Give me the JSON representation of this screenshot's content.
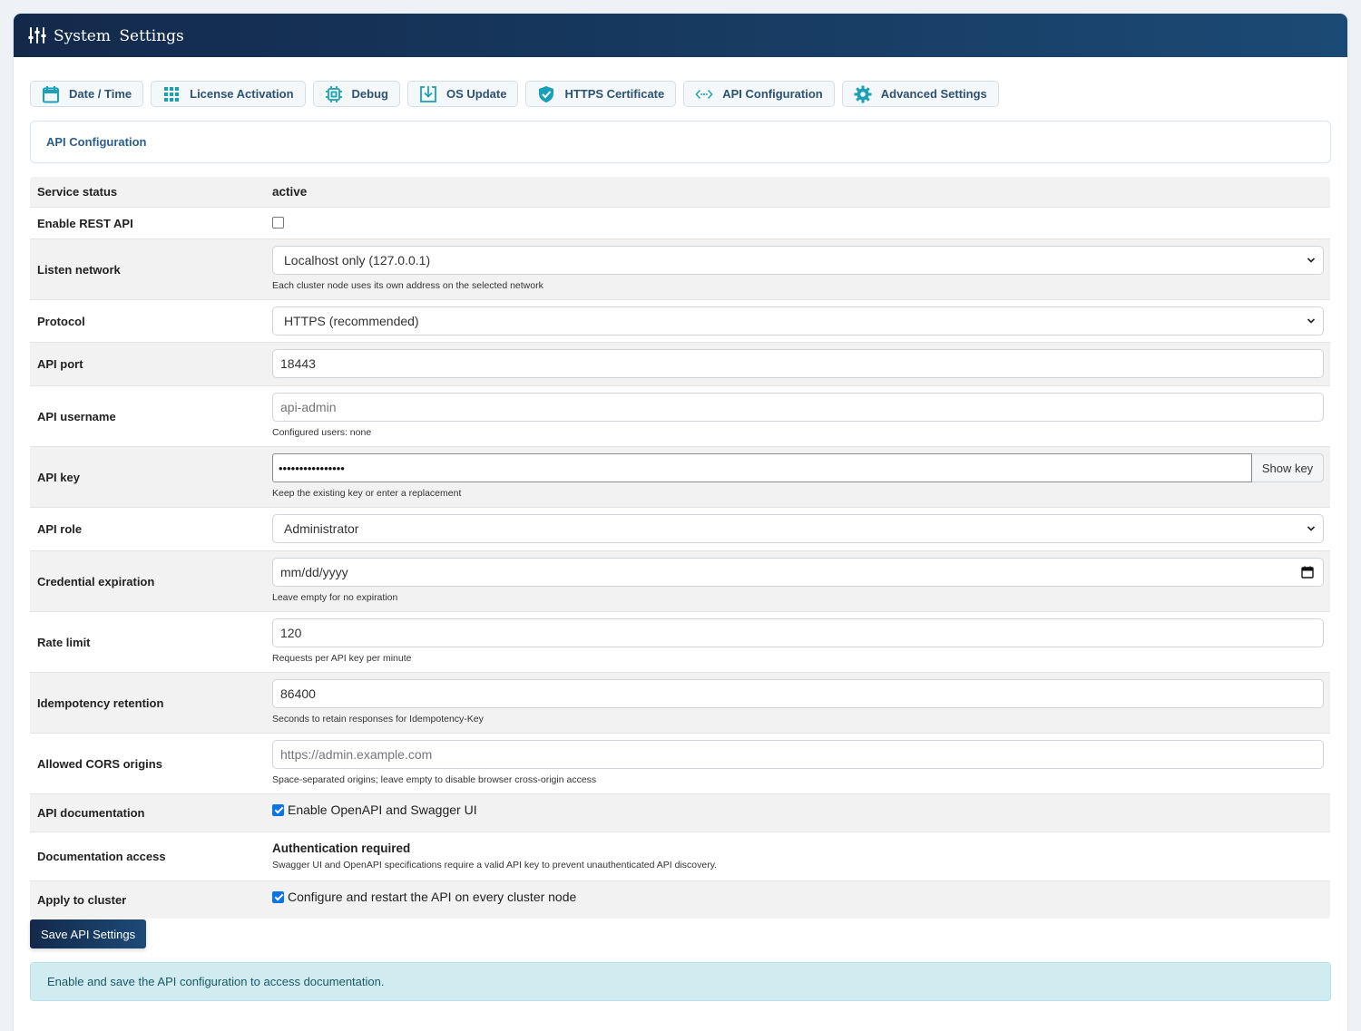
{
  "window": {
    "title": "System  Settings"
  },
  "tabs": [
    {
      "label": "Date / Time",
      "icon": "calendar-icon"
    },
    {
      "label": "License Activation",
      "icon": "grid-icon"
    },
    {
      "label": "Debug",
      "icon": "chip-icon"
    },
    {
      "label": "OS Update",
      "icon": "download-icon"
    },
    {
      "label": "HTTPS Certificate",
      "icon": "shield-check-icon"
    },
    {
      "label": "API Configuration",
      "icon": "code-icon"
    },
    {
      "label": "Advanced Settings",
      "icon": "gear-icon"
    }
  ],
  "section": {
    "title": "API Configuration"
  },
  "form": {
    "service_status": {
      "label": "Service status",
      "value": "active"
    },
    "enable_rest": {
      "label": "Enable REST API",
      "checked": false
    },
    "listen_network": {
      "label": "Listen network",
      "value": "Localhost only (127.0.0.1)",
      "help": "Each cluster node uses its own address on the selected network"
    },
    "protocol": {
      "label": "Protocol",
      "value": "HTTPS (recommended)"
    },
    "api_port": {
      "label": "API port",
      "value": "18443"
    },
    "api_username": {
      "label": "API username",
      "placeholder": "api-admin",
      "help": "Configured users: none"
    },
    "api_key": {
      "label": "API key",
      "value": "••••••••••••••••",
      "button": "Show key",
      "help": "Keep the existing key or enter a replacement"
    },
    "api_role": {
      "label": "API role",
      "value": "Administrator"
    },
    "credential_expiration": {
      "label": "Credential expiration",
      "placeholder": "mm/dd/yyyy",
      "help": "Leave empty for no expiration"
    },
    "rate_limit": {
      "label": "Rate limit",
      "value": "120",
      "help": "Requests per API key per minute"
    },
    "idempotency": {
      "label": "Idempotency retention",
      "value": "86400",
      "help": "Seconds to retain responses for Idempotency-Key"
    },
    "cors": {
      "label": "Allowed CORS origins",
      "placeholder": "https://admin.example.com",
      "help": "Space-separated origins; leave empty to disable browser cross-origin access"
    },
    "api_docs": {
      "label": "API documentation",
      "checked": true,
      "text": "Enable OpenAPI and Swagger UI"
    },
    "docs_access": {
      "label": "Documentation access",
      "title": "Authentication required",
      "help": "Swagger UI and OpenAPI specifications require a valid API key to prevent unauthenticated API discovery."
    },
    "apply_cluster": {
      "label": "Apply to cluster",
      "checked": true,
      "text": "Configure and restart the API on every cluster node"
    }
  },
  "actions": {
    "save_label": "Save API Settings"
  },
  "alert": {
    "text": "Enable and save the API configuration to access documentation."
  },
  "colors": {
    "header_start": "#13294b",
    "header_end": "#1b4a75",
    "tab_text": "#2d5273",
    "icon_teal": "#1aa0b5",
    "checkbox_blue": "#0b73e8",
    "alert_bg": "#d0ecf1"
  }
}
